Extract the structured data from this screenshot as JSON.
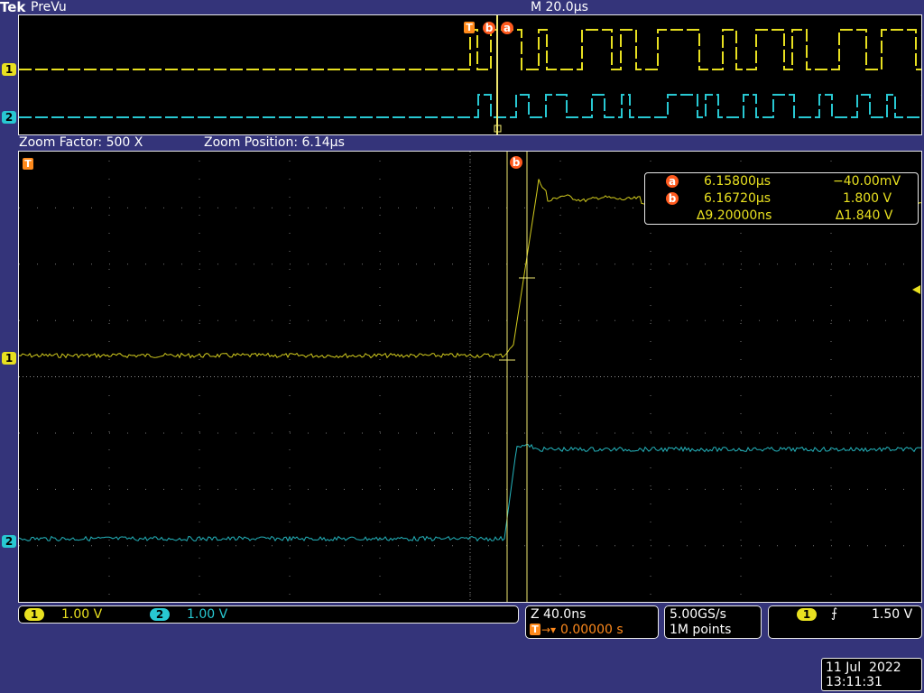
{
  "header": {
    "brand": "Tek",
    "mode": "PreVu",
    "timebase": "M 20.0µs"
  },
  "zoom_info": {
    "factor": "Zoom Factor: 500 X",
    "position": "Zoom Position: 6.14µs"
  },
  "cursor_readout": {
    "a_label": "a",
    "a_time": "6.15800µs",
    "a_value": "−40.00mV",
    "b_label": "b",
    "b_time": "6.16720µs",
    "b_value": "1.800 V",
    "delta_time": "∆9.20000ns",
    "delta_value": "∆1.840 V"
  },
  "markers": {
    "trigger": "T",
    "cursor_a": "a",
    "cursor_b": "b",
    "ch1": "1",
    "ch2": "2"
  },
  "channels": [
    {
      "id": "1",
      "scale": "1.00 V",
      "color": "#e8e020"
    },
    {
      "id": "2",
      "scale": "1.00 V",
      "color": "#28c8d2"
    }
  ],
  "horizontal": {
    "zoom_scale": "Z 40.0ns",
    "trigger_position": "0.00000 s"
  },
  "acquisition": {
    "sample_rate": "5.00GS/s",
    "record_length": "1M points"
  },
  "trigger": {
    "source": "1",
    "level": "1.50 V"
  },
  "datetime": {
    "date": "11 Jul  2022",
    "time": "13:11:31"
  },
  "colors": {
    "ch1": "#e8e020",
    "ch2": "#28c8d2",
    "cursor": "#ff5a1e",
    "trigger": "#ff8a1c",
    "background": "#34347a"
  }
}
